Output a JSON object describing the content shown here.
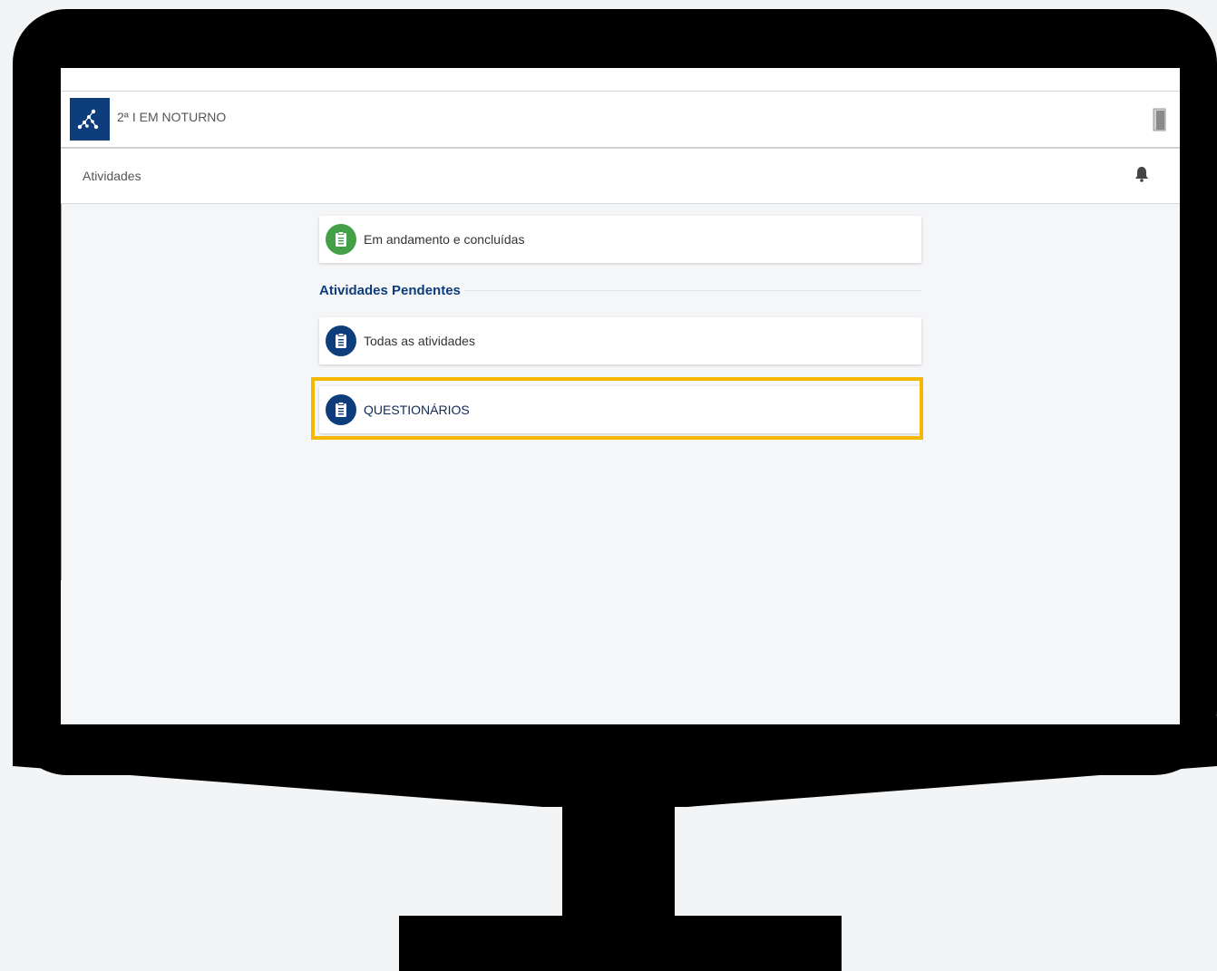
{
  "header": {
    "class_name": "2ª I EM NOTURNO",
    "logo_icon": "network-logo-icon",
    "exit_icon": "door-exit-icon"
  },
  "subheader": {
    "title": "Atividades",
    "bell_icon": "bell-icon"
  },
  "cards": [
    {
      "label": "Em andamento e concluídas",
      "icon": "clipboard-icon",
      "color": "#43a047"
    },
    {
      "label": "Todas as atividades",
      "icon": "clipboard-icon",
      "color": "#0d3d7a"
    },
    {
      "label": "QUESTIONÁRIOS",
      "icon": "clipboard-icon",
      "color": "#0d3d7a"
    }
  ],
  "section": {
    "title": "Atividades Pendentes"
  },
  "colors": {
    "brand": "#0d3d7a",
    "highlight": "#f5b800",
    "success": "#43a047"
  }
}
